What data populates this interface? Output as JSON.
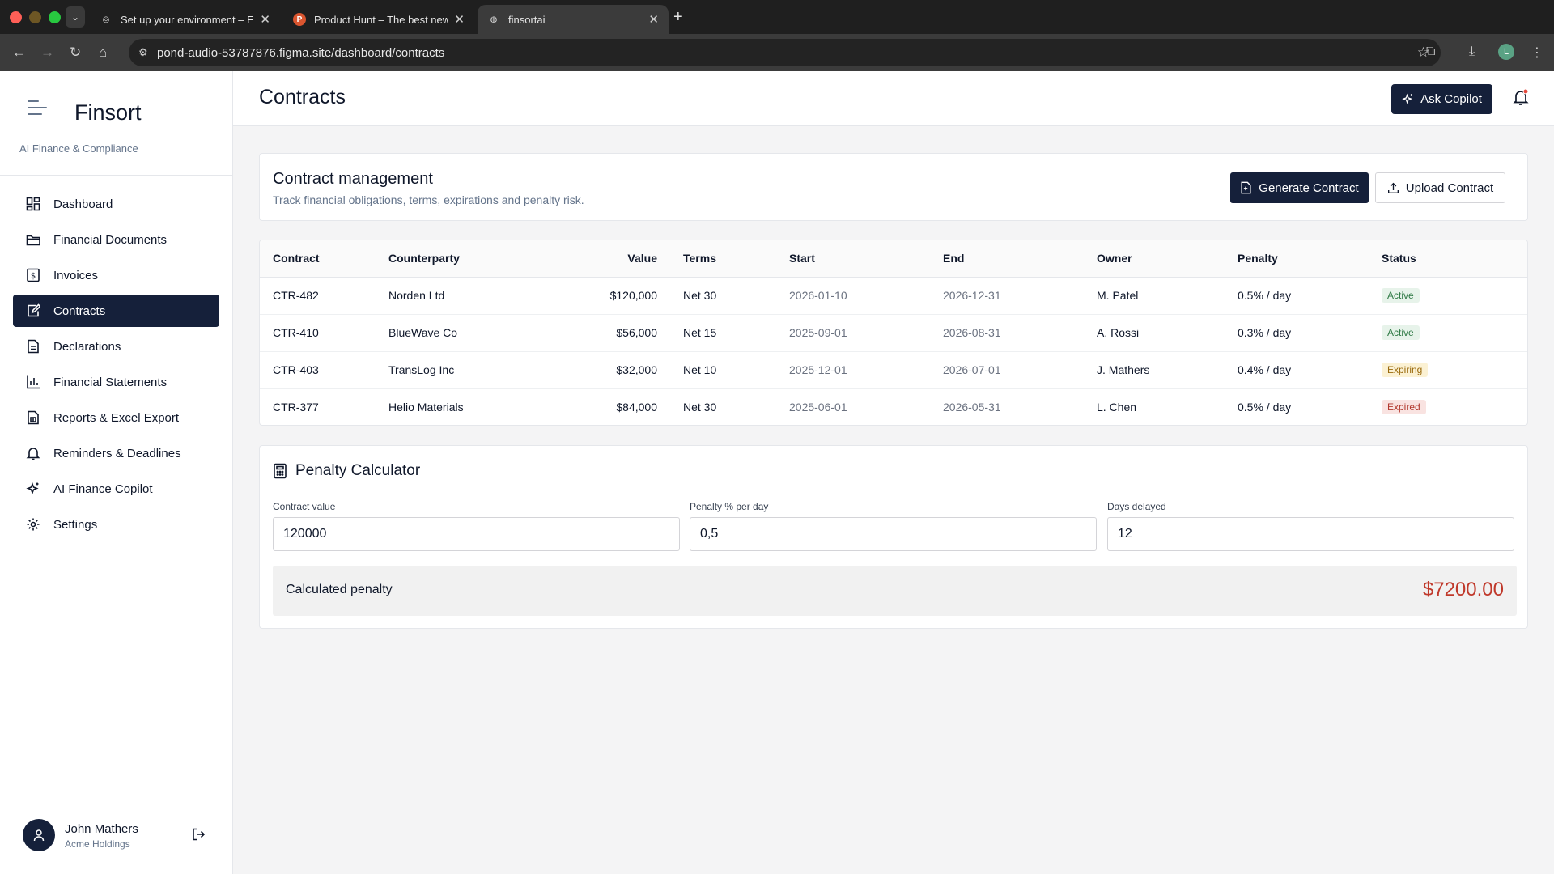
{
  "browser": {
    "tabs": [
      {
        "title": "Set up your environment – Ex"
      },
      {
        "title": "Product Hunt – The best new"
      },
      {
        "title": "finsortai"
      }
    ],
    "url": "pond-audio-53787876.figma.site/dashboard/contracts",
    "profile_initial": "L"
  },
  "sidebar": {
    "brand": "Finsort",
    "subtitle": "AI Finance & Compliance",
    "items": [
      {
        "label": "Dashboard",
        "icon": "dashboard-icon"
      },
      {
        "label": "Financial Documents",
        "icon": "folder-icon"
      },
      {
        "label": "Invoices",
        "icon": "invoice-icon"
      },
      {
        "label": "Contracts",
        "icon": "contract-icon",
        "active": true
      },
      {
        "label": "Declarations",
        "icon": "document-icon"
      },
      {
        "label": "Financial Statements",
        "icon": "bar-chart-icon"
      },
      {
        "label": "Reports & Excel Export",
        "icon": "spreadsheet-icon"
      },
      {
        "label": "Reminders & Deadlines",
        "icon": "bell-icon"
      },
      {
        "label": "AI Finance Copilot",
        "icon": "sparkles-icon"
      },
      {
        "label": "Settings",
        "icon": "gear-icon"
      }
    ],
    "user": {
      "name": "John Mathers",
      "org": "Acme Holdings"
    }
  },
  "header": {
    "title": "Contracts",
    "ask_copilot": "Ask Copilot"
  },
  "management": {
    "title": "Contract management",
    "subtitle": "Track financial obligations, terms, expirations and penalty risk.",
    "generate_label": "Generate Contract",
    "upload_label": "Upload Contract"
  },
  "table": {
    "columns": [
      "Contract",
      "Counterparty",
      "Value",
      "Terms",
      "Start",
      "End",
      "Owner",
      "Penalty",
      "Status"
    ],
    "rows": [
      [
        "CTR-482",
        "Norden Ltd",
        "$120,000",
        "Net 30",
        "2026-01-10",
        "2026-12-31",
        "M. Patel",
        "0.5% / day",
        "Active"
      ],
      [
        "CTR-410",
        "BlueWave Co",
        "$56,000",
        "Net 15",
        "2025-09-01",
        "2026-08-31",
        "A. Rossi",
        "0.3% / day",
        "Active"
      ],
      [
        "CTR-403",
        "TransLog Inc",
        "$32,000",
        "Net 10",
        "2025-12-01",
        "2026-07-01",
        "J. Mathers",
        "0.4% / day",
        "Expiring"
      ],
      [
        "CTR-377",
        "Helio Materials",
        "$84,000",
        "Net 30",
        "2025-06-01",
        "2026-05-31",
        "L. Chen",
        "0.5% / day",
        "Expired"
      ]
    ]
  },
  "calculator": {
    "title": "Penalty Calculator",
    "contract_value_label": "Contract value",
    "contract_value": "120000",
    "penalty_label": "Penalty % per day",
    "penalty_value": "0,5",
    "days_label": "Days delayed",
    "days_value": "12",
    "result_label": "Calculated penalty",
    "result_value": "$7200.00"
  },
  "colors": {
    "primary": "#15203a",
    "result": "#c0392b",
    "notification_dot": "#e5483c"
  }
}
